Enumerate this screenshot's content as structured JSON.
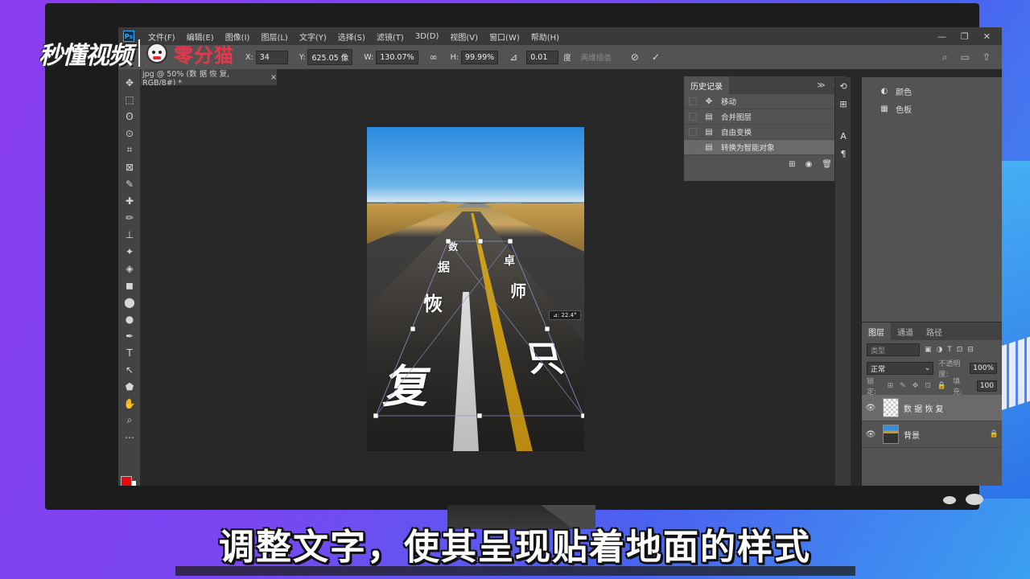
{
  "watermark": {
    "left": "秒懂视频",
    "right": "零分猫"
  },
  "menubar": {
    "logo": "Ps",
    "items": [
      "文件(F)",
      "编辑(E)",
      "图像(I)",
      "图层(L)",
      "文字(Y)",
      "选择(S)",
      "滤镜(T)",
      "3D(D)",
      "视图(V)",
      "窗口(W)",
      "帮助(H)"
    ],
    "controls": [
      "—",
      "❐",
      "✕"
    ]
  },
  "options": {
    "x_label": "X:",
    "x_value": "34",
    "y_label": "Y:",
    "y_value": "625.05 像",
    "w_label": "W:",
    "w_value": "130.07%",
    "link_icon": "∞",
    "h_label": "H:",
    "h_value": "99.99%",
    "angle_icon": "⊿",
    "angle_value": "0.01",
    "angle_unit": "度",
    "interp_label": "两维插值",
    "cancel_icon": "⊘",
    "commit_icon": "✓",
    "right_icons": [
      "⌕",
      "▭",
      "⇧"
    ]
  },
  "doc_tab": {
    "title": "jpg @ 50% (数 据 恢 复, RGB/8#) *",
    "close": "×"
  },
  "tools": [
    "✥",
    "⬚",
    "ʘ",
    "⊙",
    "⌗",
    "⊠",
    "✎",
    "✚",
    "✏",
    "⊥",
    "✦",
    "◈",
    "◼",
    "⬤",
    "●",
    "✒",
    "T",
    "↖",
    "⬟",
    "✋",
    "⌕",
    "⋯"
  ],
  "canvas": {
    "chars": [
      "数",
      "据",
      "恢",
      "复",
      "卓",
      "师",
      "只"
    ],
    "angle_label": "⊿: 22.4°"
  },
  "history": {
    "tab": "历史记录",
    "head_icons": [
      "≫",
      "≡"
    ],
    "rows": [
      {
        "label": "移动",
        "icon": "✥"
      },
      {
        "label": "合并图层",
        "icon": "▤"
      },
      {
        "label": "自由变换",
        "icon": "▤"
      },
      {
        "label": "转换为智能对象",
        "icon": "▤"
      }
    ],
    "foot_icons": [
      "⊞",
      "◉",
      "🗑"
    ]
  },
  "right_strip_icons": [
    "⟲",
    "⊞",
    "A",
    "¶"
  ],
  "right_panel": [
    {
      "label": "颜色",
      "icon": "◐"
    },
    {
      "label": "色板",
      "icon": "▦"
    }
  ],
  "layers": {
    "tabs": [
      "图层",
      "通道",
      "路径"
    ],
    "search_placeholder": "类型",
    "filter_icons": [
      "▣",
      "◑",
      "T",
      "⊡",
      "⊟"
    ],
    "blend_mode": "正常",
    "opacity_label": "不透明度:",
    "opacity_value": "100%",
    "lock_label": "锁定:",
    "lock_icons": [
      "⊞",
      "✎",
      "✥",
      "⊡",
      "🔒"
    ],
    "fill_label": "填充:",
    "fill_value": "100",
    "rows": [
      {
        "name": "数 据 恢 复",
        "visible_icon": "👁"
      },
      {
        "name": "背景",
        "visible_icon": "👁",
        "lock_icon": "🔒"
      }
    ]
  },
  "subtitle": "调整文字，使其呈现贴着地面的样式",
  "colors": {
    "foreground": "#e30b0b",
    "background": "#ffffff"
  }
}
